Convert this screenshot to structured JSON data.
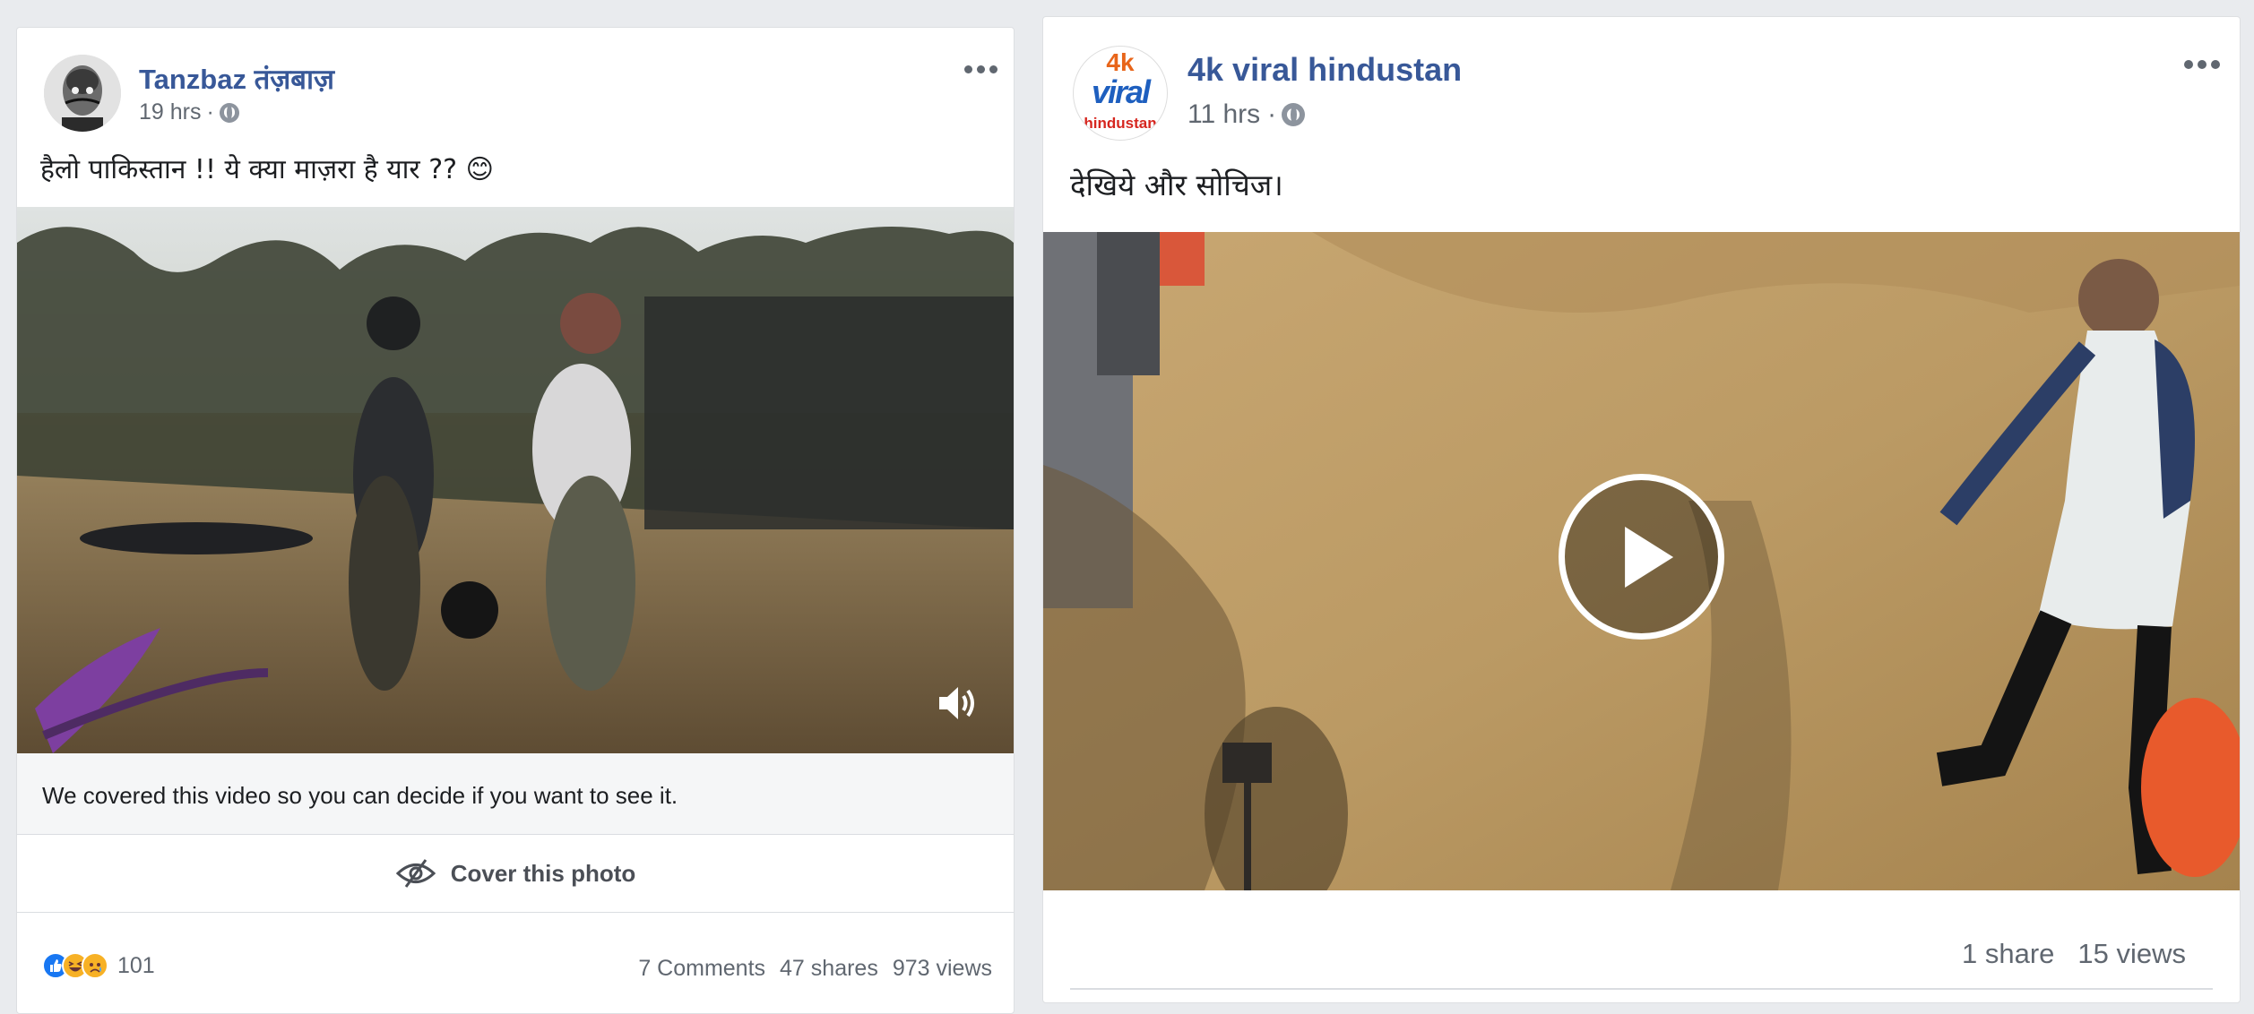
{
  "posts": [
    {
      "author": "Tanzbaz तंज़बाज़",
      "time": "19 hrs",
      "separator": "·",
      "privacy_icon": "globe-icon",
      "text": "हैलो पाकिस्तान !! ये क्या माज़रा है यार ?? 😊",
      "more_icon": "more-options-icon",
      "media_type": "video",
      "sound_icon": "speaker-icon",
      "warning_text": "We covered this video so you can decide if you want to see it.",
      "cover_button_label": "Cover this photo",
      "cover_button_icon": "eye-slash-icon",
      "reaction_icons": [
        "like-icon",
        "haha-icon",
        "sad-icon"
      ],
      "reaction_count": "101",
      "comments": "7 Comments",
      "shares": "47 shares",
      "views": "973 views"
    },
    {
      "author": "4k viral hindustan",
      "avatar_text": [
        "4k",
        "viral",
        "hindustan"
      ],
      "time": "11 hrs",
      "separator": "·",
      "privacy_icon": "globe-icon",
      "text": "देखिये और सोचिज।",
      "more_icon": "more-options-icon",
      "media_type": "video",
      "play_icon": "play-icon",
      "shares": "1 share",
      "views": "15 views"
    }
  ],
  "colors": {
    "page_bg": "#e9ebee",
    "author_link": "#385898",
    "meta_text": "#606770",
    "like_blue": "#1877f2",
    "haha_yellow": "#f7b125"
  }
}
